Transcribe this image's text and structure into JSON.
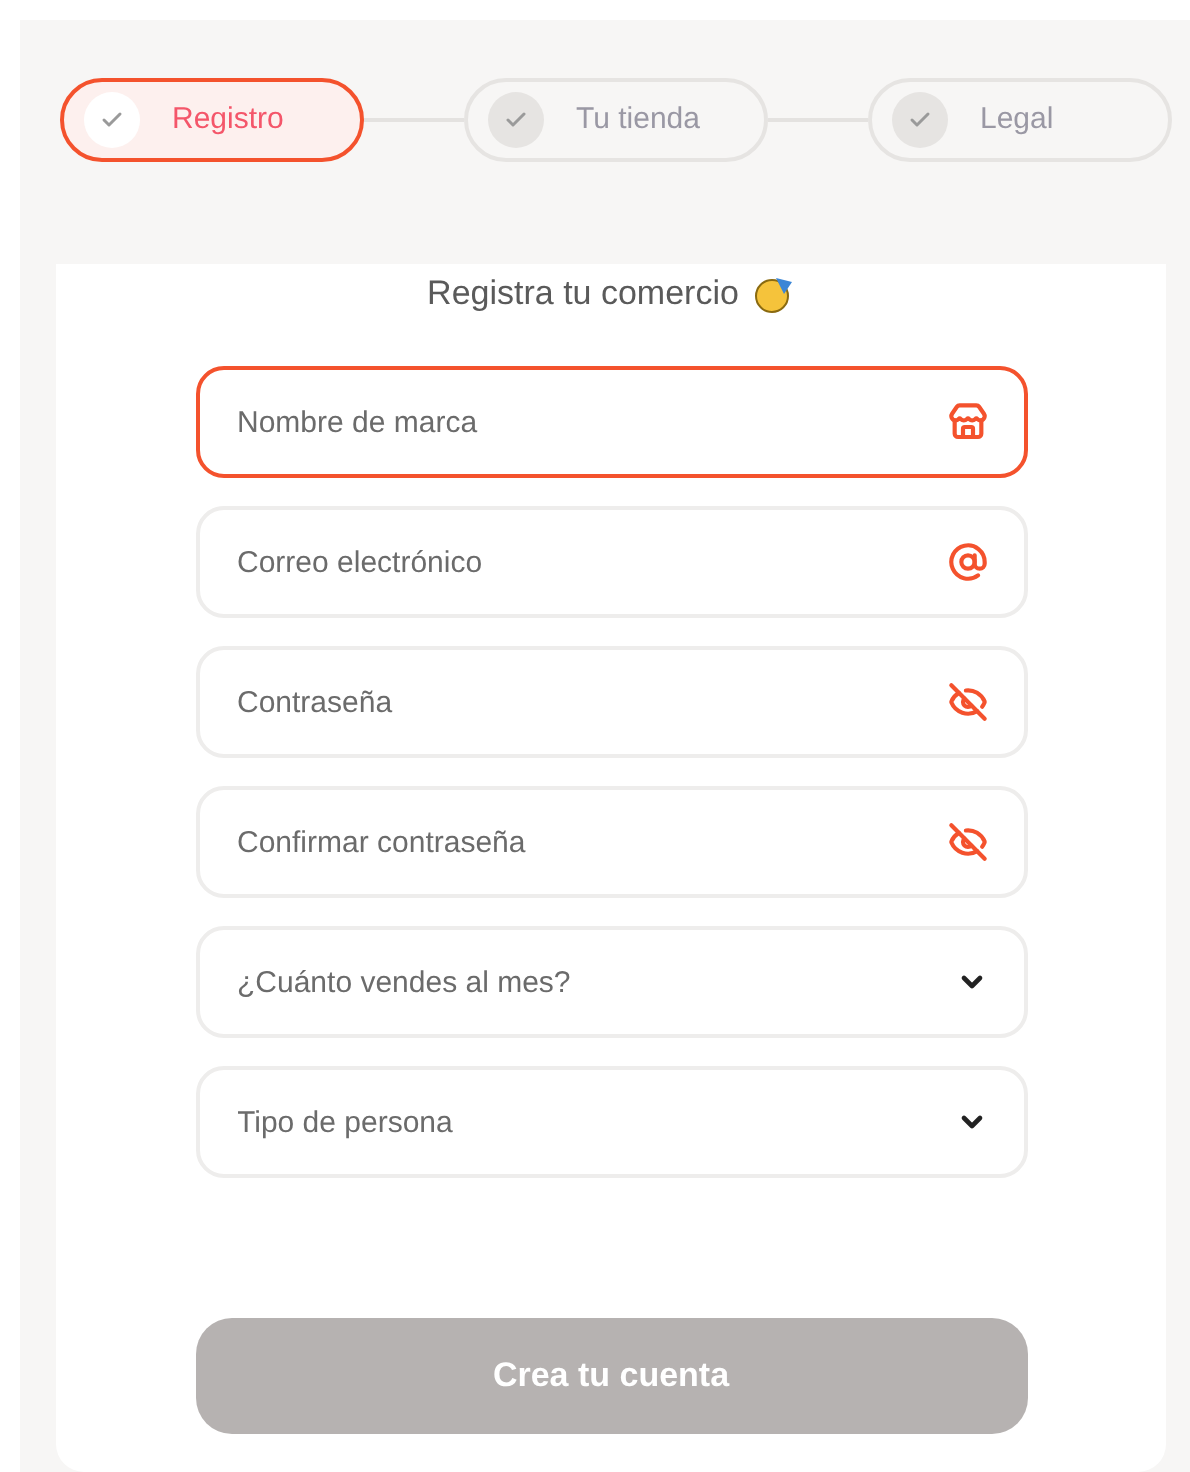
{
  "steps": [
    {
      "label": "Registro",
      "selected": true
    },
    {
      "label": "Tu tienda",
      "selected": false
    },
    {
      "label": "Legal",
      "selected": false
    }
  ],
  "form": {
    "title": "Registra tu comercio",
    "fields": [
      {
        "placeholder": "Nombre de marca",
        "kind": "store",
        "focused": true
      },
      {
        "placeholder": "Correo electrónico",
        "kind": "email",
        "focused": false
      },
      {
        "placeholder": "Contraseña",
        "kind": "password",
        "focused": false
      },
      {
        "placeholder": "Confirmar contraseña",
        "kind": "password",
        "focused": false
      },
      {
        "placeholder": "¿Cuánto vendes al mes?",
        "kind": "select",
        "focused": false
      },
      {
        "placeholder": "Tipo de persona",
        "kind": "select",
        "focused": false
      }
    ],
    "submit": {
      "label": "Crea tu cuenta",
      "disabled": true
    }
  }
}
